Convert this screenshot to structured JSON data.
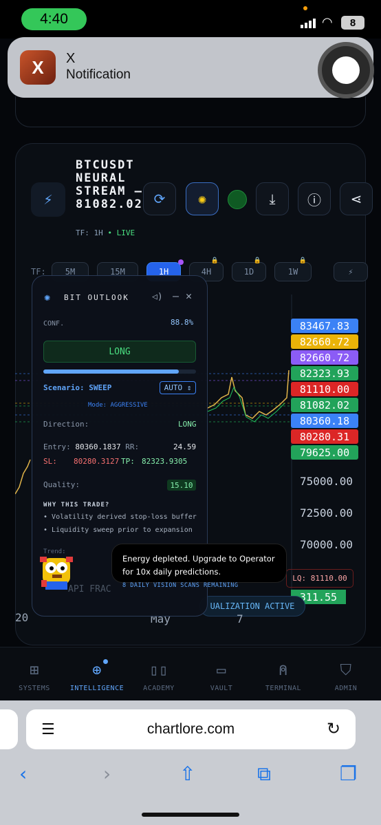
{
  "status": {
    "time": "4:40",
    "battery": "8"
  },
  "notification": {
    "app_letter": "X",
    "title": "X",
    "body": "Notification"
  },
  "header": {
    "title": "BTCUSDT NEURAL STREAM — 81082.02",
    "tf": "TF: 1H",
    "live": "• LIVE"
  },
  "timeframes": {
    "label": "TF:",
    "items": [
      "5M",
      "15M",
      "1H",
      "4H",
      "1D",
      "1W"
    ],
    "active": "1H"
  },
  "price_tags": [
    {
      "value": "83467.83",
      "color": "#3b82f6"
    },
    {
      "value": "82660.72",
      "color": "#eab308"
    },
    {
      "value": "82660.72",
      "color": "#8b5cf6"
    },
    {
      "value": "82323.93",
      "color": "#22a35a"
    },
    {
      "value": "81110.00",
      "color": "#dc2626"
    },
    {
      "value": "81082.02",
      "color": "#22a35a"
    },
    {
      "value": "80360.18",
      "color": "#3b82f6"
    },
    {
      "value": "80280.31",
      "color": "#dc2626"
    },
    {
      "value": "79625.00",
      "color": "#22a35a"
    }
  ],
  "axis_labels": [
    "75000.00",
    "72500.00",
    "70000.00"
  ],
  "lq": "LQ: 81110.00",
  "last_price": "311.55",
  "x_labels": [
    "20",
    "May",
    "7"
  ],
  "visualization": "UALIZATION ACTIVE",
  "outlook": {
    "title": "BIT OUTLOOK",
    "conf_label": "CONF.",
    "conf_value": "88.8%",
    "signal": "LONG",
    "conf_fraction": 0.888,
    "scenario_label": "Scenario:",
    "scenario_value": "SWEEP",
    "auto": "AUTO",
    "mode": "Mode: AGGRESSIVE",
    "direction_label": "Direction:",
    "direction_value": "LONG",
    "entry_label": "Entry:",
    "entry_value": "80360.1837",
    "rr_label": "RR:",
    "rr_value": "24.59",
    "sl_label": "SL:",
    "sl_value": "80280.3127",
    "tp_label": "TP:",
    "tp_value": "82323.9305",
    "quality_label": "Quality:",
    "quality_value": "15.10",
    "why_title": "WHY THIS TRADE?",
    "reasons": [
      "Volatility derived stop-loss buffer",
      "Liquidity sweep prior to expansion"
    ],
    "trend_label": "Trend:",
    "api_text": "API FRAC"
  },
  "toast": {
    "line1": "Energy depleted. Upgrade to Operator",
    "line2": "for 10x daily predictions.",
    "sub": "8 DAILY VISION SCANS REMAINING"
  },
  "nav": [
    {
      "label": "SYSTEMS",
      "icon": "grid-icon"
    },
    {
      "label": "INTELLIGENCE",
      "icon": "globe-icon"
    },
    {
      "label": "ACADEMY",
      "icon": "book-icon"
    },
    {
      "label": "VAULT",
      "icon": "wallet-icon"
    },
    {
      "label": "TERMINAL",
      "icon": "user-icon"
    },
    {
      "label": "ADMIN",
      "icon": "shield-icon"
    }
  ],
  "browser": {
    "url": "chartlore.com"
  }
}
